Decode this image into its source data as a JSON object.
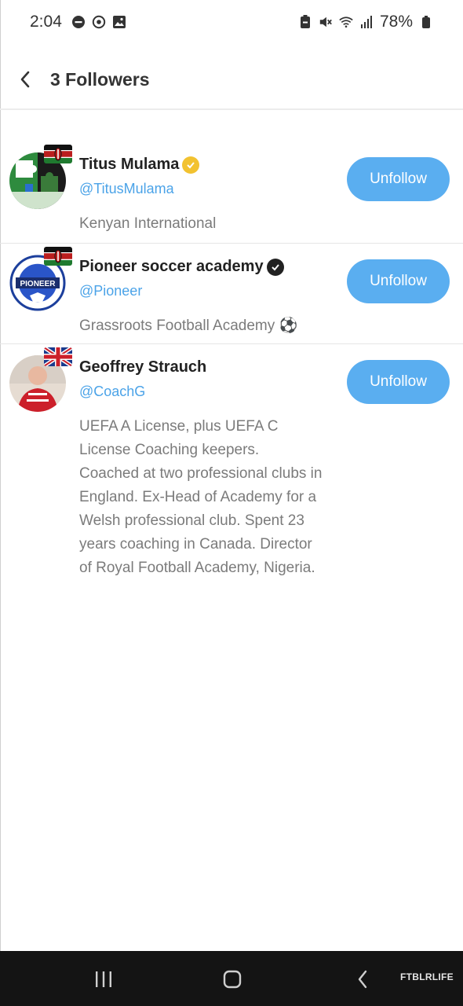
{
  "status_bar": {
    "time": "2:04",
    "battery": "78%",
    "left_icons": [
      "minus-circle-icon",
      "gauge-icon",
      "image-icon"
    ],
    "right_icons": [
      "battery-saver-icon",
      "mute-icon",
      "wifi-icon",
      "signal-icon",
      "battery-icon"
    ]
  },
  "header": {
    "title": "3 Followers",
    "back_icon": "chevron-left-icon"
  },
  "followers": [
    {
      "name": "Titus Mulama",
      "handle": "@TitusMulama",
      "bio": "Kenyan International",
      "badge_color": "#f2c230",
      "flag": "kenya-flag",
      "button_label": "Unfollow"
    },
    {
      "name": "Pioneer soccer academy",
      "handle": "@Pioneer",
      "bio": "Grassroots Football Academy ⚽",
      "badge_color": "#222222",
      "flag": "kenya-flag",
      "avatar_text": "PIONEER",
      "button_label": "Unfollow"
    },
    {
      "name": "Geoffrey Strauch",
      "handle": "@CoachG",
      "bio": "UEFA A License, plus UEFA C License Coaching keepers. Coached at two professional clubs in England. Ex-Head of Academy for a Welsh professional club. Spent 23 years coaching in Canada. Director of Royal Football Academy, Nigeria.",
      "flag": "uk-flag",
      "button_label": "Unfollow"
    }
  ],
  "nav_bar": {
    "watermark": "FTBLRLIFE",
    "icons": [
      "recent-apps-icon",
      "home-icon",
      "back-icon"
    ]
  },
  "colors": {
    "accent": "#5aaef0",
    "handle": "#4ba3e8",
    "bio": "#7b7b7b"
  }
}
